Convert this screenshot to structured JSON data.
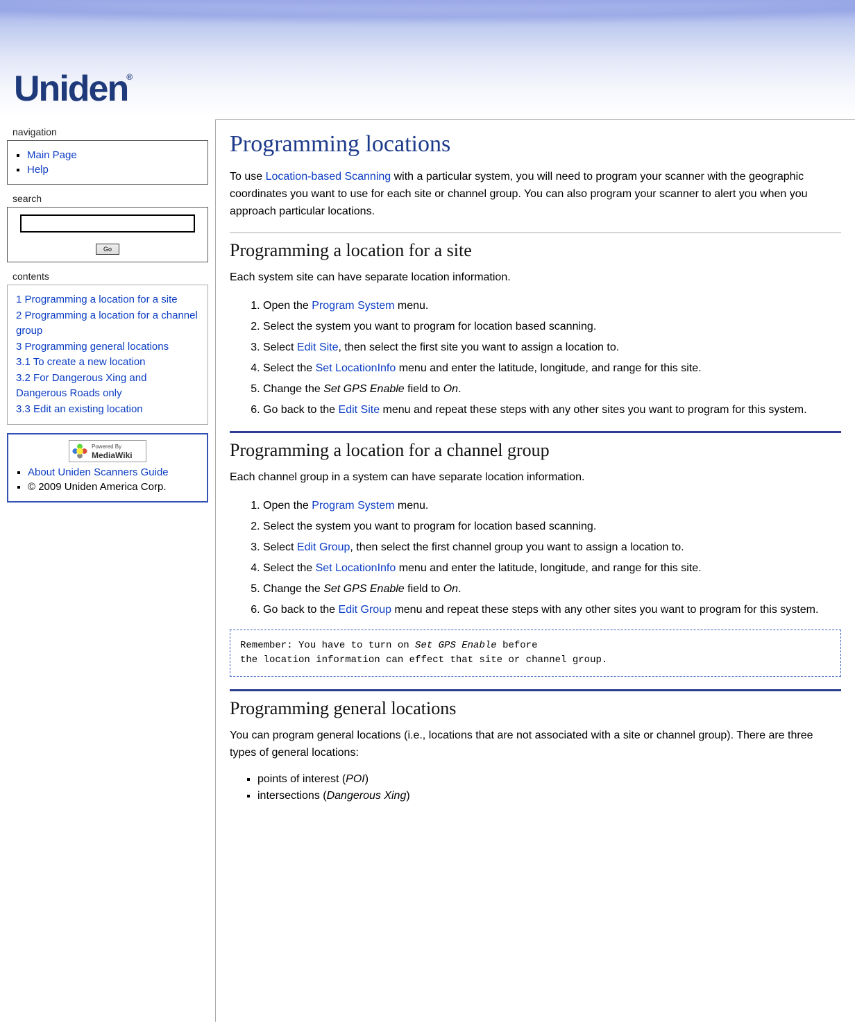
{
  "logo_text": "Uniden",
  "sidebar": {
    "nav_title": "navigation",
    "nav_items": [
      {
        "label": "Main Page"
      },
      {
        "label": "Help"
      }
    ],
    "search_title": "search",
    "search_value": "",
    "go_label": "Go",
    "contents_title": "contents",
    "toc": [
      {
        "num": "1",
        "label": "Programming a location for a site"
      },
      {
        "num": "2",
        "label": "Programming a location for a channel group"
      },
      {
        "num": "3",
        "label": "Programming general locations"
      },
      {
        "num": "3.1",
        "label": "To create a new location"
      },
      {
        "num": "3.2",
        "label": "For Dangerous Xing and Dangerous Roads only"
      },
      {
        "num": "3.3",
        "label": "Edit an existing location"
      }
    ],
    "footer": {
      "about_label": "About Uniden Scanners Guide",
      "copyright": "© 2009 Uniden America Corp.",
      "badge_powered": "Powered By",
      "badge_name": "MediaWiki"
    }
  },
  "page": {
    "title": "Programming locations",
    "intro_before": "To use ",
    "intro_link": "Location-based Scanning",
    "intro_after": " with a particular system, you will need to program your scanner with the geographic coordinates you want to use for each site or channel group. You can also program your scanner to alert you when you approach particular locations.",
    "s1": {
      "heading": "Programming a location for a site",
      "lead": "Each system site can have separate location information.",
      "li1_a": "Open the ",
      "li1_link": "Program System",
      "li1_b": " menu.",
      "li2": "Select the system you want to program for location based scanning.",
      "li3_a": "Select ",
      "li3_link": "Edit Site",
      "li3_b": ", then select the first site you want to assign a location to.",
      "li4_a": "Select the ",
      "li4_link": "Set LocationInfo",
      "li4_b": " menu and enter the latitude, longitude, and range for this site.",
      "li5_a": "Change the ",
      "li5_em": "Set GPS Enable",
      "li5_b": " field to ",
      "li5_em2": "On",
      "li5_c": ".",
      "li6_a": "Go back to the ",
      "li6_link": "Edit Site",
      "li6_b": " menu and repeat these steps with any other sites you want to program for this system."
    },
    "s2": {
      "heading": "Programming a location for a channel group",
      "lead": "Each channel group in a system can have separate location information.",
      "li1_a": "Open the ",
      "li1_link": "Program System",
      "li1_b": " menu.",
      "li2": "Select the system you want to program for location based scanning.",
      "li3_a": "Select ",
      "li3_link": "Edit Group",
      "li3_b": ", then select the first channel group you want to assign a location to.",
      "li4_a": "Select the ",
      "li4_link": "Set LocationInfo",
      "li4_b": " menu and enter the latitude, longitude, and range for this site.",
      "li5_a": "Change the ",
      "li5_em": "Set GPS Enable",
      "li5_b": " field to ",
      "li5_em2": "On",
      "li5_c": ".",
      "li6_a": "Go back to the ",
      "li6_link": "Edit Group",
      "li6_b": " menu and repeat these steps with any other sites you want to program for this system."
    },
    "note_a": "Remember: You have to turn on ",
    "note_em": "Set GPS Enable",
    "note_b": " before\nthe location information can effect that site or channel group.",
    "s3": {
      "heading": "Programming general locations",
      "lead": "You can program general locations (i.e., locations that are not associated with a site or channel group). There are three types of general locations:",
      "b1_a": "points of interest (",
      "b1_em": "POI",
      "b1_b": ")",
      "b2_a": "intersections (",
      "b2_em": "Dangerous Xing",
      "b2_b": ")"
    }
  }
}
